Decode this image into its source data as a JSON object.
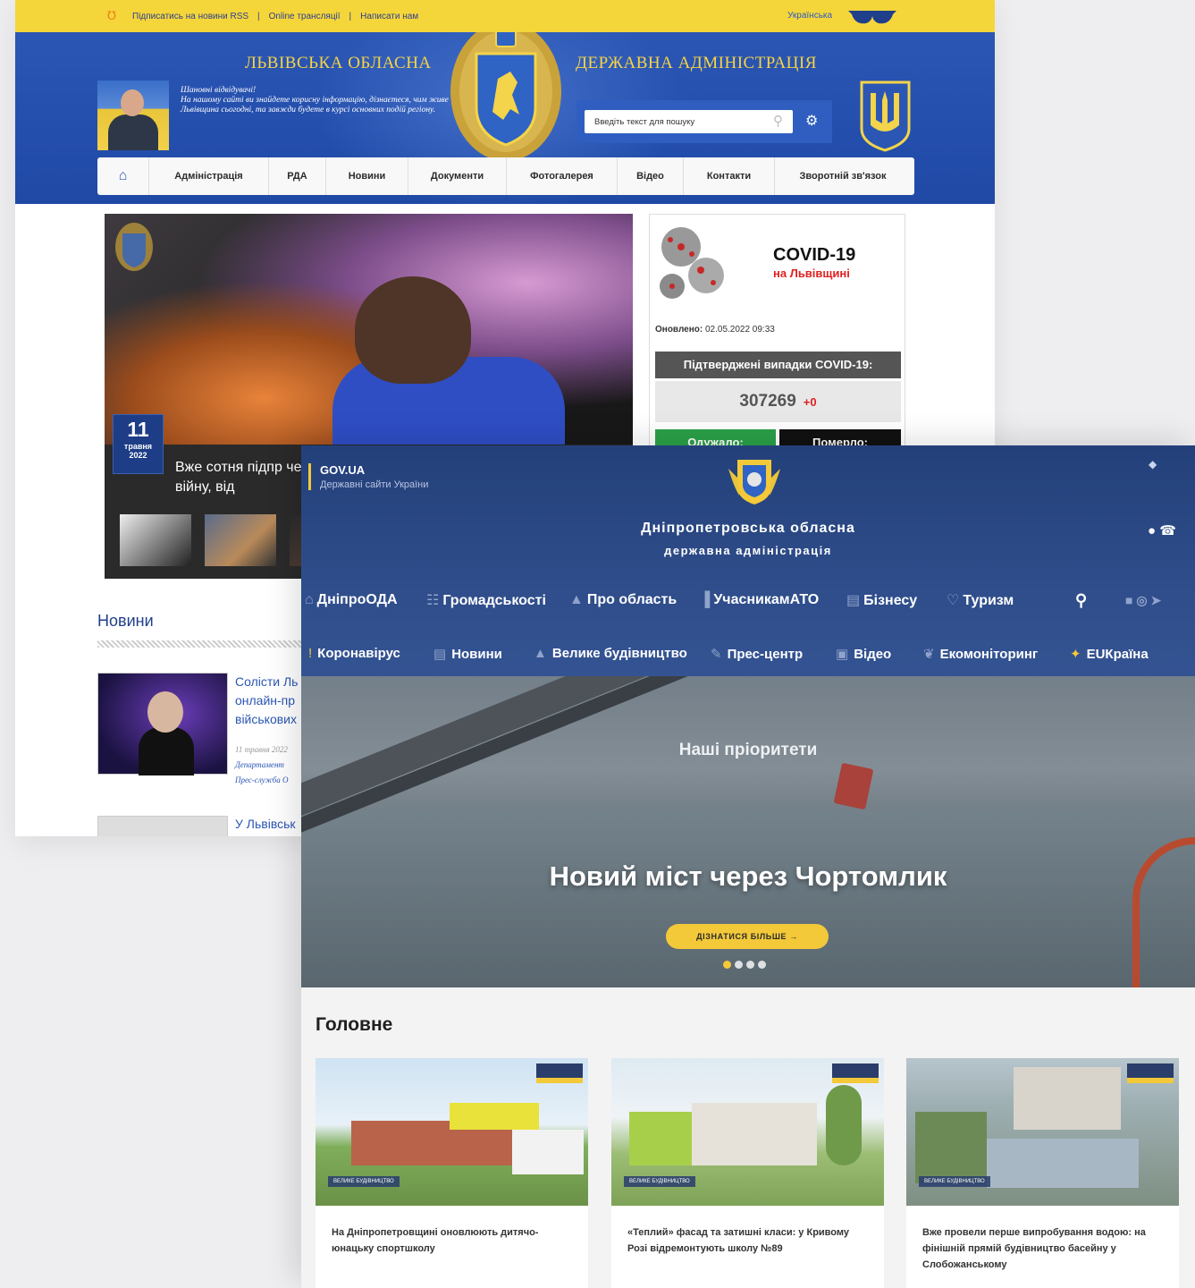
{
  "lviv": {
    "topbar": {
      "rss": "Підписатись на новини RSS",
      "online": "Online трансляції",
      "write": "Написати нам",
      "separator": "|",
      "language": "Українська"
    },
    "header": {
      "title_left": "ЛЬВІВСЬКА ОБЛАСНА",
      "title_right": "ДЕРЖАВНА АДМІНІСТРАЦІЯ",
      "greeting_line1": "Шановні відвідувачі!",
      "greeting_line2": "На нашому сайті ви знайдете корисну інформацію, дізнаєтеся, чим живе Львівщина сьогодні, та завжди будете в курсі основних подій регіону.",
      "search_placeholder": "Введіть текст для пошуку"
    },
    "nav": [
      "Адміністрація",
      "РДА",
      "Новини",
      "Документи",
      "Фотогалерея",
      "Відео",
      "Контакти",
      "Зворотній зв'язок"
    ],
    "slider": {
      "day": "11",
      "month": "травня",
      "year": "2022",
      "caption": "Вже сотня підпр через війну, від"
    },
    "covid": {
      "title": "COVID-19",
      "subtitle": "на Львівщині",
      "updated_label": "Оновлено:",
      "updated_value": "02.05.2022 09:33",
      "confirmed_label": "Підтверджені випадки COVID-19:",
      "confirmed_count": "307269",
      "confirmed_delta": "+0",
      "recovered_label": "Одужало:",
      "died_label": "Померло:"
    },
    "news": {
      "heading": "Новини",
      "item1_title": "Солісти Ль онлайн-пр військових",
      "item1_date": "11 травня 2022",
      "item1_dept": "Департамент",
      "item1_source": "Прес-служба О",
      "item2_title": "У Львівськ"
    }
  },
  "dnipro": {
    "gov_title": "GOV.UA",
    "gov_subtitle": "Державні сайти України",
    "title_line1": "Дніпропетровська обласна",
    "title_line2": "державна адміністрація",
    "nav1": [
      "ДніпроОДА",
      "Громадськості",
      "Про область",
      "УчасникамАТО",
      "Бізнесу",
      "Туризм"
    ],
    "nav2": [
      "Коронавірус",
      "Новини",
      "Велике будівництво",
      "Прес-центр",
      "Відео",
      "Екомоніторинг",
      "EUКраїна"
    ],
    "hero": {
      "priorities": "Наші пріоритети",
      "headline": "Новий міст через Чортомлик",
      "button": "ДІЗНАТИСЯ БІЛЬШЕ →"
    },
    "main_heading": "Головне",
    "cards": [
      {
        "tag": "ВЕЛИКЕ БУДІВНИЦТВО",
        "text": "На Дніпропетровщині оновлюють дитячо-юнацьку спортшколу"
      },
      {
        "tag": "ВЕЛИКЕ БУДІВНИЦТВО",
        "text": "«Теплий» фасад та затишні класи: у Кривому Розі відремонтують школу №89"
      },
      {
        "tag": "ВЕЛИКЕ БУДІВНИЦТВО",
        "text": "Вже провели перше випробування водою: на фінішній прямій будівництво басейну у Слобожанському"
      }
    ]
  },
  "colors": {
    "lviv_yellow": "#f5d63a",
    "lviv_blue": "#2b56b4",
    "dnipro_navy": "#2f4d8a",
    "dnipro_accent": "#f3c93a",
    "covid_red": "#e12020"
  }
}
